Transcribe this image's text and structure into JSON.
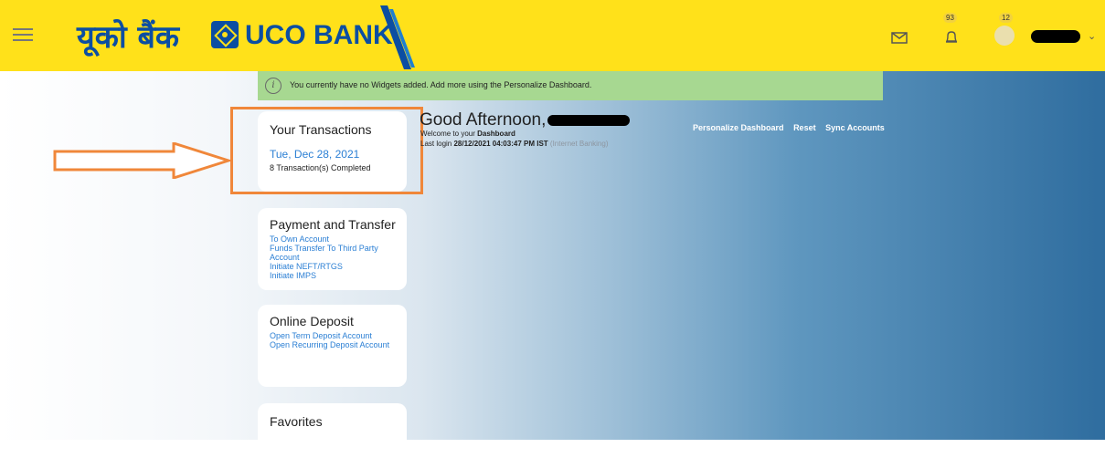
{
  "header": {
    "logo_hindi": "यूको बैंक",
    "logo_english": "UCO BANK",
    "notification_count": "93",
    "message_count": "12",
    "icons": {
      "menu": "hamburger-icon",
      "mail": "mail-icon",
      "bell": "bell-icon",
      "user": "avatar",
      "chevron": "chevron-down-icon"
    }
  },
  "notice": {
    "text": "You currently have no Widgets added. Add more using the Personalize Dashboard."
  },
  "transactions_card": {
    "title": "Your Transactions",
    "date": "Tue, Dec 28, 2021",
    "count_text": "8 Transaction(s) Completed"
  },
  "payment_card": {
    "title": "Payment and Transfer",
    "links": [
      "To Own Account",
      "Funds Transfer To Third Party Account",
      "Initiate NEFT/RTGS",
      "Initiate IMPS"
    ]
  },
  "deposit_card": {
    "title": "Online Deposit",
    "links": [
      "Open Term Deposit Account",
      "Open Recurring Deposit Account"
    ]
  },
  "favorites_card": {
    "title": "Favorites"
  },
  "greeting": {
    "title": "Good Afternoon,",
    "welcome_prefix": "Welcome to your",
    "welcome_bold": "Dashboard",
    "last_login_label": "Last login",
    "last_login_value": "28/12/2021 04:03:47 PM IST",
    "last_login_channel": "(Internet Banking)"
  },
  "actions": {
    "personalize": "Personalize Dashboard",
    "reset": "Reset",
    "sync": "Sync Accounts"
  },
  "colors": {
    "header_bg": "#ffe11a",
    "brand_blue": "#0b4ea2",
    "link_blue": "#2b7fd4",
    "notice_bg": "#a7d891",
    "annotation_orange": "#f0873a"
  }
}
